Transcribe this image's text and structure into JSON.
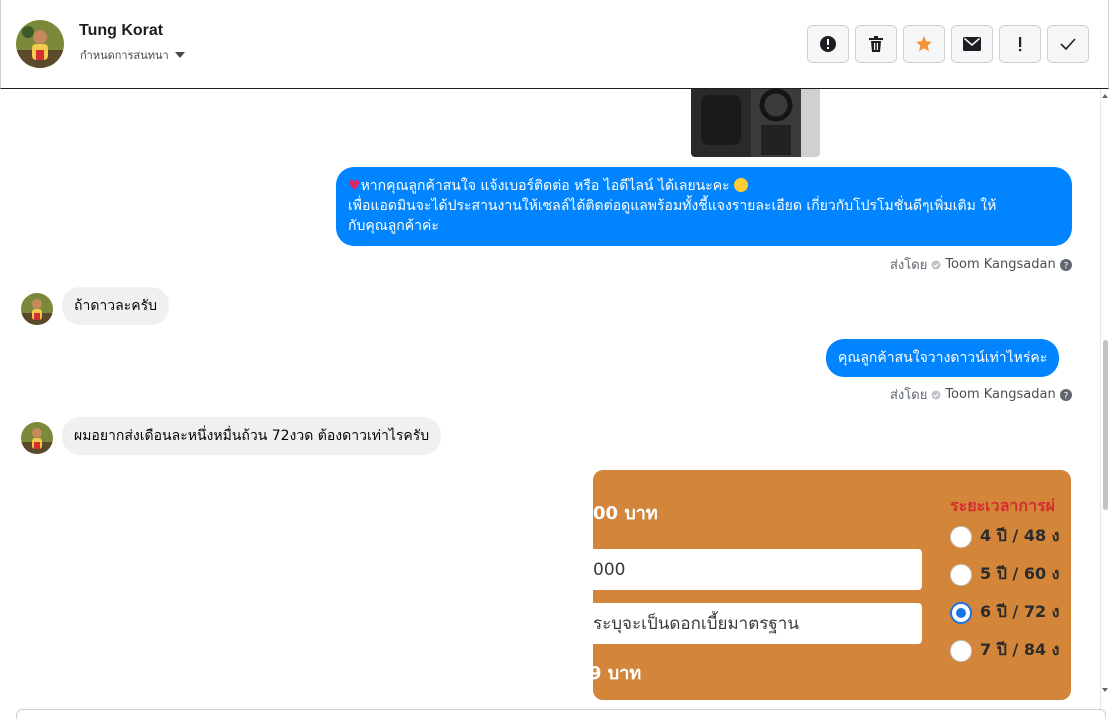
{
  "header": {
    "name": "Tung Korat",
    "subtitle": "กำหนดการสนทนา",
    "actions": [
      {
        "name": "spam-report",
        "icon": "alert-circle-icon"
      },
      {
        "name": "delete",
        "icon": "trash-icon"
      },
      {
        "name": "star",
        "icon": "star-icon"
      },
      {
        "name": "mark-unread",
        "icon": "envelope-icon"
      },
      {
        "name": "follow-up",
        "icon": "exclamation-icon"
      },
      {
        "name": "mark-done",
        "icon": "check-icon"
      }
    ]
  },
  "messages": {
    "m1_line1": "หากคุณลูกค้าสนใจ แจ้งเบอร์ติดต่อ หรือ ไอดีไลน์ ได้เลยนะคะ",
    "m1_line2": "เพื่อแอดมินจะได้ประสานงานให้เซลล์ได้ติดต่อดูแลพร้อมทั้งชี้แจงรายละเอียด เกี่ยวกับโปรโมชั่นดีๆเพิ่มเติม ให้",
    "m1_line3": "กับคุณลูกค้าค่ะ",
    "m2": "ถ้าดาวละครับ",
    "m3": "คุณลูกค้าสนใจวางดาวน์เท่าไหร่คะ",
    "m4": "ผมอยากส่งเดือนละหนึ่งหมื่นถ้วน 72งวด ต้องดาวเท่าไรครับ"
  },
  "sent_by": {
    "prefix": "ส่งโดย",
    "agent": "Toom Kangsadan"
  },
  "loan_image": {
    "amount_label": "00 บาท",
    "field1_value": "000",
    "field2_value": "ระบุจะเป็นดอกเบี้ยมาตรฐาน",
    "total_label": "9 บาท",
    "term_title": "ระยะเวลาการผ่",
    "options": [
      {
        "label": "4 ปี / 48 ง",
        "selected": false
      },
      {
        "label": "5 ปี / 60 ง",
        "selected": false
      },
      {
        "label": "6 ปี / 72 ง",
        "selected": true
      },
      {
        "label": "7 ปี / 84 ง",
        "selected": false
      }
    ]
  },
  "colors": {
    "outgoing_bubble": "#0084ff",
    "incoming_bubble": "#f0f0f0",
    "star_active": "#f7923b",
    "loan_background": "#d3853a"
  }
}
